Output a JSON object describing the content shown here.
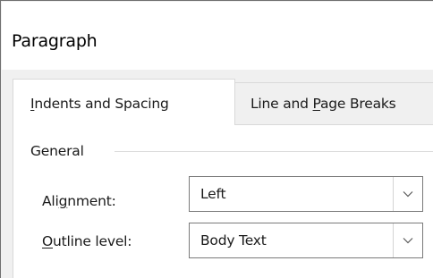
{
  "dialog": {
    "title": "Paragraph"
  },
  "tabs": [
    {
      "label_pre": "",
      "label_accel": "I",
      "label_post": "ndents and Spacing",
      "selected": true
    },
    {
      "label_pre": "Line and ",
      "label_accel": "P",
      "label_post": "age Breaks",
      "selected": false
    }
  ],
  "general": {
    "group_label": "General",
    "alignment": {
      "label_pre": "Ali",
      "label_accel": "g",
      "label_post": "nment:",
      "value": "Left",
      "icon": "chevron-down-icon"
    },
    "outline_level": {
      "label_pre": "",
      "label_accel": "O",
      "label_post": "utline level:",
      "value": "Body Text",
      "icon": "chevron-down-icon"
    }
  },
  "colors": {
    "dialog_bg": "#f0f0f0",
    "panel_bg": "#ffffff",
    "border": "#7a7a7a"
  }
}
